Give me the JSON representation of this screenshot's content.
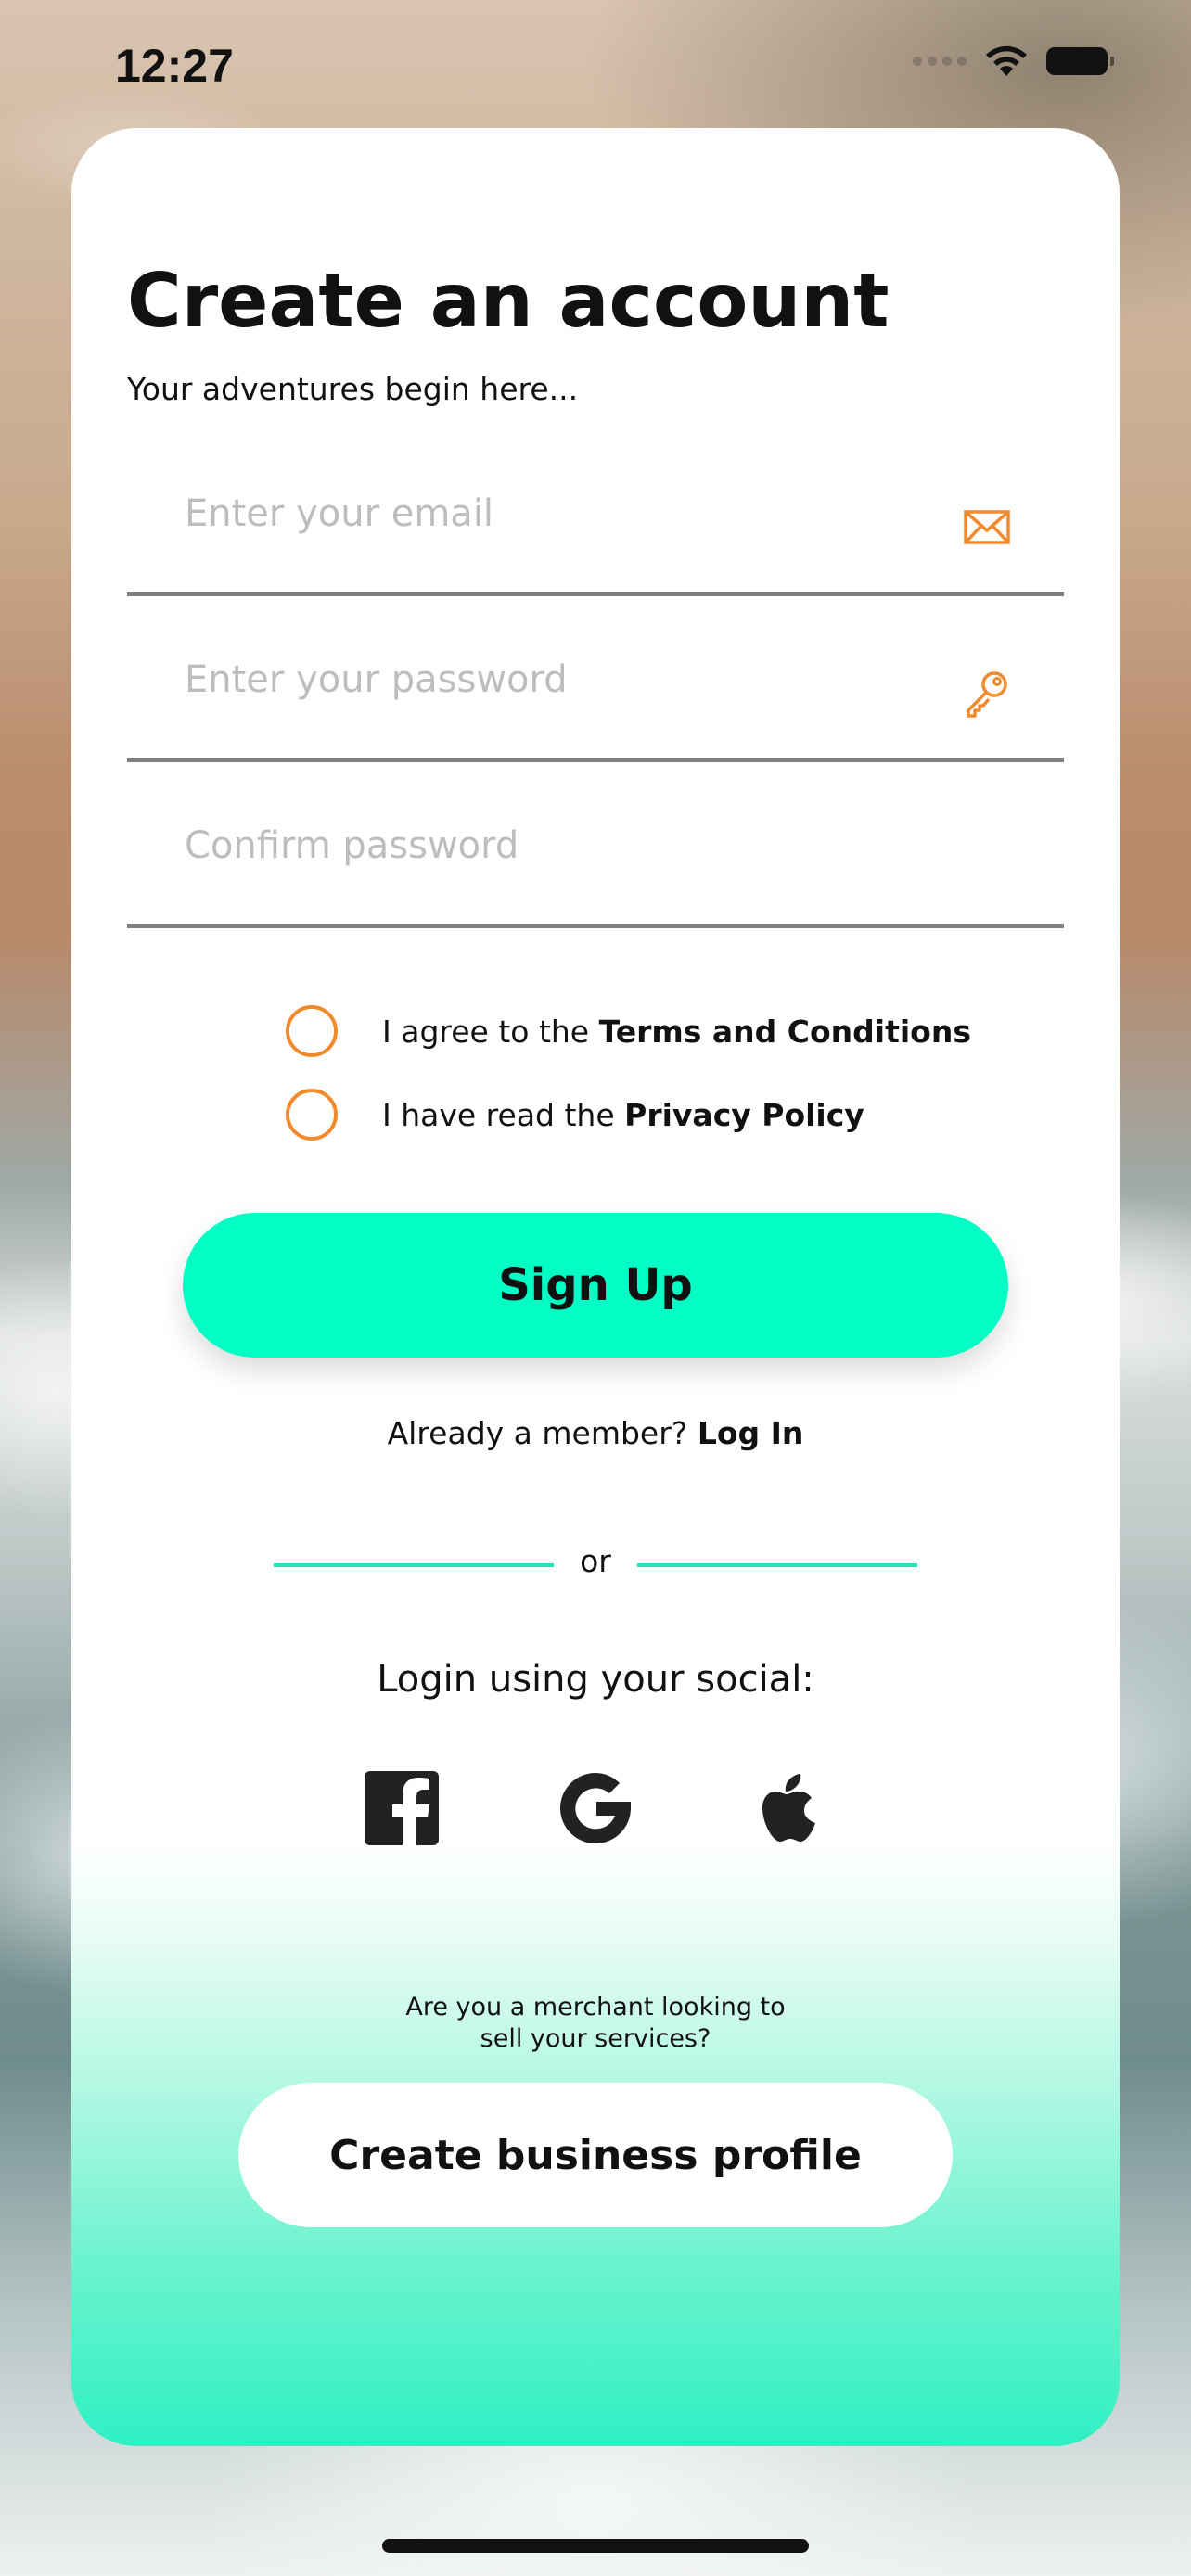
{
  "status_bar": {
    "time": "12:27"
  },
  "header": {
    "title": "Create an account",
    "subtitle": "Your adventures begin here..."
  },
  "form": {
    "email_placeholder": "Enter your email",
    "password_placeholder": "Enter your password",
    "confirm_placeholder": "Confirm password",
    "email_icon": "envelope-icon",
    "password_icon": "key-icon"
  },
  "agreements": [
    {
      "prefix": "I agree to the ",
      "link": "Terms and Conditions"
    },
    {
      "prefix": "I have read the ",
      "link": "Privacy Policy"
    }
  ],
  "signup_label": "Sign Up",
  "member": {
    "prefix": "Already a member? ",
    "login_label": "Log In"
  },
  "divider_text": "or",
  "social": {
    "title": "Login using your social:",
    "icons": [
      "facebook-icon",
      "google-icon",
      "apple-icon"
    ]
  },
  "merchant": {
    "line1": "Are you a merchant looking to",
    "line2": "sell your services?",
    "button_label": "Create business profile"
  },
  "colors": {
    "accent": "#03fdc5",
    "icon_orange": "#f08a2c",
    "field_border": "#7f7f7f"
  }
}
